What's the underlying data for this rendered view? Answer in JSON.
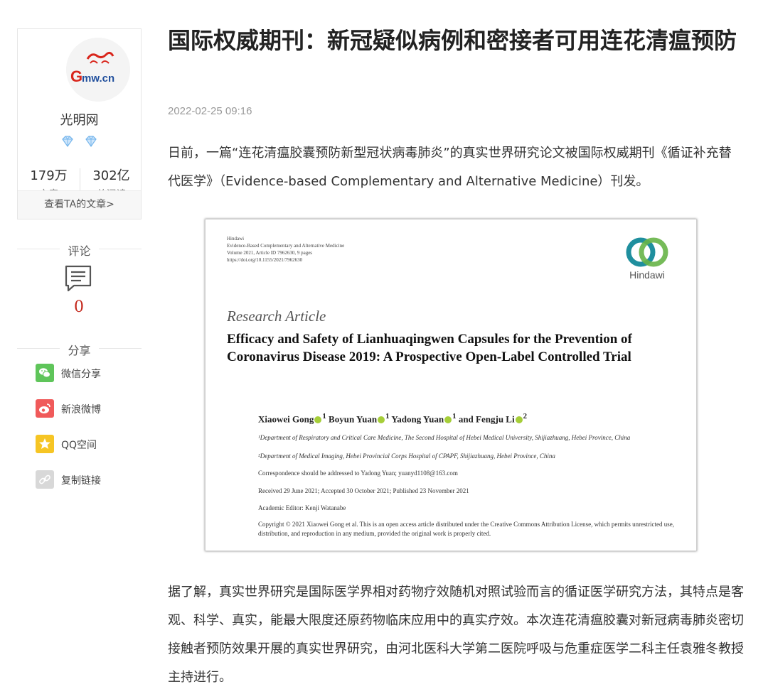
{
  "author": {
    "name": "光明网",
    "logo_text": "Gmw.cn",
    "stats": [
      {
        "value": "179万",
        "label": "文章"
      },
      {
        "value": "302亿",
        "label": "总阅读"
      }
    ],
    "view_articles": "查看TA的文章>"
  },
  "comments": {
    "heading": "评论",
    "count": "0"
  },
  "share": {
    "heading": "分享",
    "items": [
      {
        "label": "微信分享",
        "icon": "wechat-icon",
        "color": "#5fc55a"
      },
      {
        "label": "新浪微博",
        "icon": "weibo-icon",
        "color": "#f05a5a"
      },
      {
        "label": "QQ空间",
        "icon": "qzone-icon",
        "color": "#f6c524"
      },
      {
        "label": "复制链接",
        "icon": "link-icon",
        "color": "#d8d8d8"
      }
    ]
  },
  "article": {
    "title": "国际权威期刊：新冠疑似病例和密接者可用连花清瘟预防",
    "date": "2022-02-25 09:16",
    "paragraph1": "日前，一篇“连花清瘟胶囊预防新型冠状病毒肺炎”的真实世界研究论文被国际权威期刊《循证补充替代医学》（Evidence-based Complementary and Alternative Medicine）刊发。",
    "paragraph2": "据了解，真实世界研究是国际医学界相对药物疗效随机对照试验而言的循证医学研究方法，其特点是客观、科学、真实，能最大限度还原药物临床应用中的真实疗效。本次连花清瘟胶囊对新冠病毒肺炎密切接触者预防效果开展的真实世界研究，由河北医科大学第二医院呼吸与危重症医学二科主任袁雅冬教授主持进行。"
  },
  "paper": {
    "meta": [
      "Hindawi",
      "Evidence-Based Complementary and Alternative Medicine",
      "Volume 2021, Article ID 7962630, 9 pages",
      "https://doi.org/10.1155/2021/7962630"
    ],
    "publisher": "Hindawi",
    "type": "Research Article",
    "title": "Efficacy and Safety of Lianhuaqingwen Capsules for the Prevention of Coronavirus Disease 2019: A Prospective Open-Label Controlled Trial",
    "authors": [
      {
        "name": "Xiaowei Gong",
        "sup": "1"
      },
      {
        "name": "Boyun Yuan",
        "sup": "1"
      },
      {
        "name": "Yadong Yuan",
        "sup": "1"
      },
      {
        "name": "Fengju Li",
        "sup": "2"
      }
    ],
    "affiliation1": "¹Department of Respiratory and Critical Care Medicine, The Second Hospital of Hebei Medical University, Shijiazhuang, Hebei Province, China",
    "affiliation2": "²Department of Medical Imaging, Hebei Provincial Corps Hospital of CPAPF, Shijiazhuang, Hebei Province, China",
    "correspondence": "Correspondence should be addressed to Yadong Yuan; yuanyd1108@163.com",
    "received": "Received 29 June 2021; Accepted 30 October 2021; Published 23 November 2021",
    "editor": "Academic Editor: Kenji Watanabe",
    "copyright": "Copyright © 2021 Xiaowei Gong et al. This is an open access article distributed under the Creative Commons Attribution License, which permits unrestricted use, distribution, and reproduction in any medium, provided the original work is properly cited."
  },
  "colors": {
    "accent_red": "#c4281c",
    "hindawi_teal": "#1f8f9e",
    "hindawi_green": "#67b447",
    "orcid_green": "#a6ce39"
  }
}
